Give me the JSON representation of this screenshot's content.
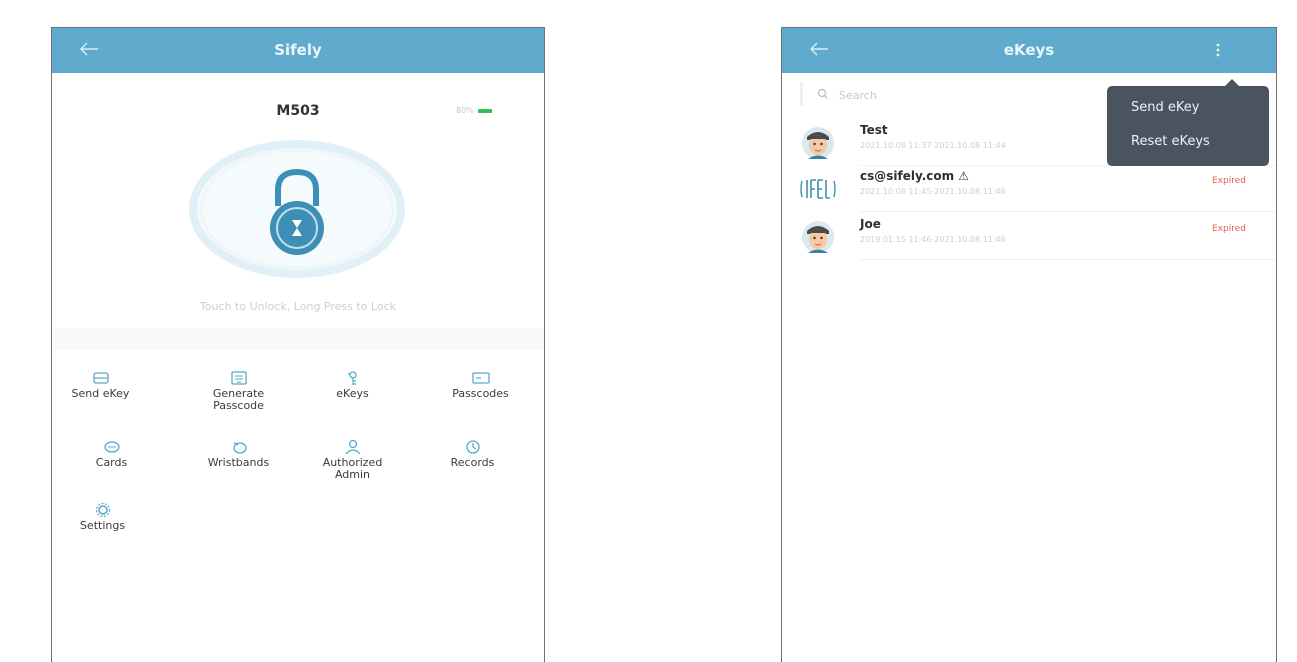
{
  "left_screen": {
    "title": "Sifely",
    "back_icon": "back-arrow-icon",
    "lock_name": "M503",
    "battery": {
      "text": "80%",
      "color": "#2fbf55"
    },
    "unlock_hint": "Touch to Unlock, Long Press to Lock",
    "menu": [
      {
        "label": "Send eKey",
        "icon": "send-ekey-icon"
      },
      {
        "label": "Generate\nPasscode",
        "icon": "keyboard-icon"
      },
      {
        "label": "eKeys",
        "icon": "ekeys-icon"
      },
      {
        "label": "Passcodes",
        "icon": "passcodes-icon"
      },
      {
        "label": "Cards",
        "icon": "card-icon"
      },
      {
        "label": "Wristbands",
        "icon": "wristband-icon"
      },
      {
        "label": "Authorized\nAdmin",
        "icon": "admin-user-icon"
      },
      {
        "label": "Records",
        "icon": "records-clock-icon"
      },
      {
        "label": "Settings",
        "icon": "gear-icon"
      }
    ]
  },
  "right_screen": {
    "title": "eKeys",
    "back_icon": "back-arrow-icon",
    "more_icon": "more-vertical-icon",
    "search": {
      "placeholder": "Search",
      "value": ""
    },
    "ekeys": [
      {
        "name": "Test",
        "meta": "2021.10.08 11:37-2021.10.08 11:44",
        "status": "",
        "avatar": "avatar-face"
      },
      {
        "name": "cs@sifely.com ⚠",
        "meta": "2021.10.08 11:45-2021.10.08 11:46",
        "status": "Expired",
        "avatar": "sifely-logo"
      },
      {
        "name": "Joe",
        "meta": "2019.01.15 11:46-2021.10.08 11:46",
        "status": "Expired",
        "avatar": "avatar-face"
      }
    ],
    "popup_menu": [
      "Send eKey",
      "Reset eKeys"
    ]
  },
  "colors": {
    "titlebar": "#60abcd",
    "accent": "#3d8fb5",
    "expired": "#e8604f",
    "popup_bg": "#4a5360"
  }
}
